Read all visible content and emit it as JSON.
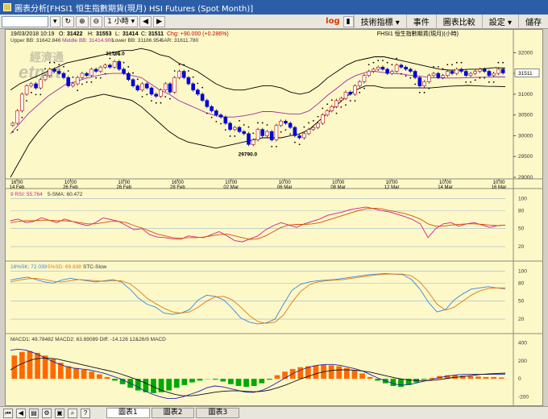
{
  "window": {
    "title": "圖表分析[FHSI1 恒生指數期貨(現月) HSI Futures (Spot Month)]"
  },
  "toolbar": {
    "symbol": "",
    "interval": "1 小時",
    "log_label": "log",
    "menus": [
      "技術指標 ▾",
      "事件",
      "圖表比較",
      "設定 ▾",
      "儲存"
    ]
  },
  "header": {
    "datetime": "19/03/2018 10:19",
    "o_label": "O:",
    "o_val": "31422",
    "h_label": "H:",
    "h_val": "31553",
    "l_label": "L:",
    "l_val": "31414",
    "c_label": "C:",
    "c_val": "31511",
    "chg": "Chg: +90.000 (+0.286%)",
    "right_title": "FHSI1  恒生指數期貨(現月)(小時)"
  },
  "bb_legend": {
    "upper": "Upper BB: 31642.846",
    "middle": "Middle BB: 31414.900",
    "lower": "Lower BB: 31186.954",
    "sar": "SAR: 31611.780"
  },
  "watermark": {
    "chinese": "經濟通",
    "brand": "etnet"
  },
  "annotations": {
    "high": "31786.0",
    "low": "29790.0"
  },
  "last_price": "31511",
  "rsi_legend": {
    "rsi": "9 RSI: 55.764",
    "sma": "5-SMA: 60.472"
  },
  "stc_legend": {
    "sk": "18%SK: 72.039",
    "sd": "5%SD: 69.838",
    "name": "STC-Slow"
  },
  "macd_legend": {
    "text": "MACD1: 49.78482 MACD2: 63.89089 Diff: -14.126 12&26/9 MACD"
  },
  "tabs": [
    "圖表1",
    "圖表2",
    "圖表3"
  ],
  "colors": {
    "background": "#fdf8c8",
    "up_candle": "#ffffff",
    "down_candle": "#0000dd",
    "bollinger": "#000000",
    "middle_bb": "#a02ca0",
    "rsi": "#d0208a",
    "sma": "#d85000",
    "stc_k": "#3a86e0",
    "stc_d": "#e07a10",
    "macd_pos": "#ff6a00",
    "macd_neg": "#00aa00"
  },
  "chart_data": [
    {
      "type": "candlestick",
      "title": "",
      "yticks": [
        29000,
        29500,
        30000,
        30500,
        31000,
        31500,
        32000
      ],
      "ylim": [
        29000,
        32200
      ],
      "xticks": [
        "16:00 14 Feb",
        "10:00 26 Feb",
        "10:00 26 Feb",
        "16:00 28 Feb",
        "10:00 02 Mar",
        "10:00 06 Mar",
        "10:00 08 Mar",
        "10:00 12 Mar",
        "10:00 14 Mar",
        "10:00 16 Mar"
      ],
      "close": [
        30300,
        30600,
        31000,
        31200,
        31250,
        31150,
        31350,
        31450,
        31600,
        31550,
        31500,
        31400,
        31200,
        31250,
        31400,
        31500,
        31450,
        31600,
        31550,
        31650,
        31700,
        31650,
        31786,
        31600,
        31500,
        31350,
        31200,
        31100,
        31250,
        31150,
        31000,
        30950,
        31100,
        31250,
        31050,
        31400,
        31550,
        31400,
        31250,
        31100,
        31000,
        30850,
        30700,
        30600,
        30500,
        30450,
        30300,
        30150,
        30200,
        30100,
        30050,
        29790,
        29900,
        30150,
        30000,
        30100,
        29900,
        30250,
        30350,
        30300,
        30200,
        30000,
        29950,
        30050,
        30150,
        30200,
        30300,
        30500,
        30600,
        30700,
        30850,
        30900,
        31050,
        31000,
        31200,
        31300,
        31450,
        31550,
        31600,
        31650,
        31600,
        31500,
        31550,
        31700,
        31650,
        31600,
        31550,
        31400,
        31200,
        31300,
        31450,
        31500,
        31400,
        31450,
        31550,
        31500,
        31600,
        31550,
        31450,
        31500,
        31550,
        31600,
        31550,
        31450,
        31500,
        31600,
        31511
      ],
      "upper_bb": [
        31100,
        31250,
        31350,
        31450,
        31550,
        31650,
        31750,
        31800,
        31850,
        31900,
        31950,
        32000,
        32050,
        32050,
        32100,
        32050,
        31950,
        31900,
        31750,
        31650,
        31550,
        31400,
        31250,
        31150,
        31100,
        31100,
        31150,
        31200,
        31200,
        31150,
        31050,
        31000,
        31050,
        31200,
        31400,
        31550,
        31700,
        31800,
        31850,
        31900,
        31900,
        31850,
        31800,
        31750,
        31700,
        31650,
        31600,
        31580,
        31580,
        31600,
        31600,
        31620,
        31640,
        31630
      ],
      "lower_bb": [
        29000,
        29400,
        29800,
        30100,
        30350,
        30550,
        30700,
        30800,
        30900,
        30950,
        31000,
        30950,
        30900,
        30850,
        30700,
        30500,
        30300,
        30100,
        29950,
        29850,
        29800,
        29750,
        29700,
        29750,
        29800,
        29850,
        29900,
        29950,
        29950,
        29950,
        30000,
        30050,
        30150,
        30350,
        30550,
        30750,
        30950,
        31100,
        31200,
        31200,
        31150,
        31150,
        31150,
        31150,
        31150,
        31150,
        31170,
        31190,
        31200,
        31210,
        31200,
        31190,
        31187,
        31180
      ],
      "middle_bb": [
        30050,
        30300,
        30550,
        30750,
        30950,
        31100,
        31250,
        31300,
        31380,
        31430,
        31480,
        31500,
        31500,
        31450,
        31400,
        31250,
        31100,
        31000,
        30850,
        30750,
        30650,
        30550,
        30480,
        30450,
        30450,
        30480,
        30520,
        30580,
        30580,
        30550,
        30520,
        30520,
        30600,
        30780,
        30980,
        31150,
        31330,
        31450,
        31520,
        31550,
        31520,
        31500,
        31480,
        31450,
        31430,
        31400,
        31390,
        31390,
        31390,
        31400,
        31405,
        31410,
        31415,
        31415
      ]
    },
    {
      "type": "line",
      "title": "",
      "yticks": [
        20,
        50,
        80,
        100
      ],
      "ylim": [
        0,
        110
      ],
      "series": [
        {
          "name": "9 RSI",
          "values": [
            63,
            66,
            60,
            62,
            68,
            64,
            60,
            66,
            62,
            58,
            55,
            60,
            68,
            65,
            62,
            55,
            48,
            50,
            40,
            36,
            35,
            33,
            32,
            38,
            36,
            35,
            40,
            45,
            38,
            30,
            28,
            33,
            38,
            48,
            55,
            60,
            56,
            52,
            58,
            62,
            66,
            72,
            75,
            78,
            82,
            84,
            86,
            83,
            80,
            78,
            74,
            70,
            65,
            58,
            35,
            50,
            58,
            60,
            54,
            58,
            60,
            56,
            52,
            55,
            56
          ]
        },
        {
          "name": "5-SMA",
          "values": [
            60,
            62,
            63,
            63,
            64,
            64,
            63,
            63,
            62,
            60,
            58,
            58,
            60,
            62,
            62,
            60,
            55,
            51,
            46,
            41,
            38,
            35,
            34,
            35,
            35,
            36,
            38,
            40,
            41,
            38,
            35,
            32,
            33,
            38,
            45,
            52,
            56,
            57,
            57,
            58,
            60,
            64,
            68,
            72,
            76,
            80,
            83,
            84,
            83,
            80,
            78,
            75,
            71,
            66,
            58,
            54,
            54,
            56,
            57,
            58,
            58,
            57,
            56,
            55,
            56
          ]
        }
      ]
    },
    {
      "type": "line",
      "title": "",
      "yticks": [
        20,
        50,
        80,
        100
      ],
      "ylim": [
        0,
        110
      ],
      "series": [
        {
          "name": "18%SK",
          "values": [
            85,
            88,
            90,
            86,
            82,
            80,
            85,
            88,
            86,
            84,
            82,
            84,
            86,
            82,
            70,
            55,
            45,
            40,
            30,
            28,
            30,
            36,
            52,
            60,
            58,
            52,
            38,
            22,
            15,
            12,
            14,
            20,
            45,
            68,
            78,
            82,
            84,
            85,
            86,
            88,
            90,
            92,
            94,
            95,
            96,
            95,
            94,
            86,
            70,
            48,
            32,
            36,
            52,
            62,
            70,
            72,
            74,
            72,
            72
          ]
        },
        {
          "name": "5%SD",
          "values": [
            82,
            85,
            87,
            88,
            86,
            83,
            82,
            84,
            86,
            85,
            84,
            83,
            84,
            84,
            79,
            68,
            55,
            46,
            38,
            32,
            30,
            32,
            40,
            50,
            57,
            58,
            52,
            40,
            26,
            16,
            13,
            15,
            27,
            48,
            66,
            77,
            82,
            84,
            85,
            86,
            88,
            90,
            92,
            94,
            95,
            95,
            95,
            92,
            82,
            65,
            45,
            35,
            40,
            50,
            60,
            67,
            71,
            72,
            70
          ]
        }
      ]
    },
    {
      "type": "bar",
      "title": "",
      "yticks": [
        -200,
        0,
        200,
        400
      ],
      "ylim": [
        -260,
        460
      ],
      "series": [
        {
          "name": "Diff",
          "values": [
            260,
            300,
            310,
            290,
            260,
            220,
            180,
            140,
            120,
            100,
            80,
            50,
            20,
            -20,
            -60,
            -100,
            -130,
            -150,
            -160,
            -150,
            -130,
            -100,
            -70,
            -40,
            -20,
            0,
            -10,
            -30,
            -60,
            -80,
            -90,
            -80,
            -50,
            -10,
            40,
            80,
            110,
            130,
            140,
            150,
            155,
            150,
            140,
            120,
            100,
            60,
            20,
            -20,
            -50,
            -80,
            -90,
            -70,
            -40,
            -10,
            10,
            30,
            40,
            40,
            35,
            30,
            25,
            20,
            20,
            15
          ]
        },
        {
          "name": "MACD1",
          "values": [
            320,
            330,
            320,
            290,
            250,
            210,
            170,
            140,
            120,
            110,
            100,
            80,
            60,
            30,
            0,
            -40,
            -80,
            -130,
            -170,
            -200,
            -220,
            -220,
            -200,
            -170,
            -140,
            -100,
            -80,
            -90,
            -110,
            -130,
            -150,
            -150,
            -130,
            -90,
            -40,
            10,
            60,
            100,
            130,
            150,
            160,
            160,
            150,
            130,
            110,
            80,
            40,
            0,
            -30,
            -60,
            -70,
            -60,
            -40,
            -20,
            0,
            20,
            35,
            45,
            50,
            50,
            50,
            50,
            50,
            50
          ]
        },
        {
          "name": "MACD2",
          "values": [
            100,
            150,
            190,
            220,
            230,
            230,
            220,
            200,
            180,
            160,
            140,
            120,
            100,
            80,
            55,
            25,
            -5,
            -40,
            -80,
            -120,
            -150,
            -175,
            -190,
            -190,
            -180,
            -165,
            -150,
            -140,
            -135,
            -135,
            -140,
            -145,
            -140,
            -125,
            -100,
            -70,
            -35,
            0,
            30,
            60,
            80,
            95,
            100,
            100,
            95,
            85,
            70,
            50,
            30,
            10,
            -5,
            -15,
            -20,
            -20,
            -15,
            -5,
            10,
            20,
            30,
            40,
            50,
            55,
            60,
            64
          ]
        }
      ]
    }
  ]
}
